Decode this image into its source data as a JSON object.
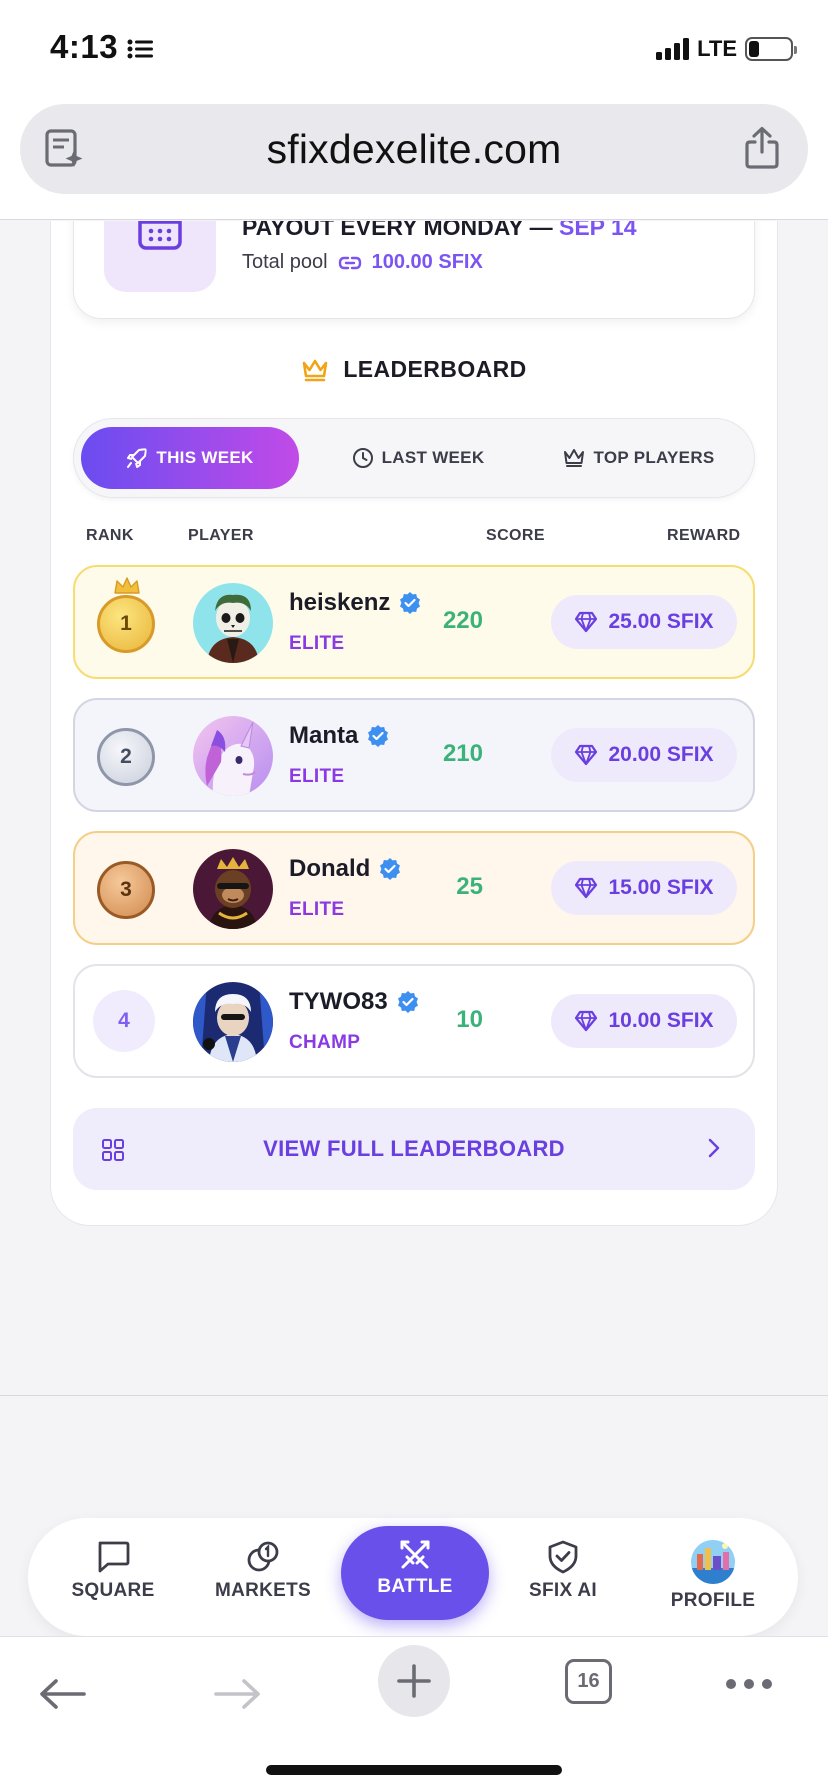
{
  "status_bar": {
    "time": "4:13",
    "network": "LTE"
  },
  "browser": {
    "url": "sfixdexelite.com",
    "tab_count": "16"
  },
  "payout": {
    "title": "PAYOUT EVERY MONDAY — ",
    "date": "SEP 14",
    "pool_label": "Total pool",
    "pool_amount": "100.00 SFIX"
  },
  "leaderboard": {
    "title": "LEADERBOARD",
    "tabs": [
      {
        "label": "THIS WEEK",
        "active": true
      },
      {
        "label": "LAST WEEK",
        "active": false
      },
      {
        "label": "TOP PLAYERS",
        "active": false
      }
    ],
    "columns": {
      "rank": "RANK",
      "player": "PLAYER",
      "score": "SCORE",
      "reward": "REWARD"
    },
    "rows": [
      {
        "rank": "1",
        "name": "heiskenz",
        "tier": "ELITE",
        "score": "220",
        "reward": "25.00 SFIX",
        "verified": true
      },
      {
        "rank": "2",
        "name": "Manta",
        "tier": "ELITE",
        "score": "210",
        "reward": "20.00 SFIX",
        "verified": true
      },
      {
        "rank": "3",
        "name": "Donald",
        "tier": "ELITE",
        "score": "25",
        "reward": "15.00 SFIX",
        "verified": true
      },
      {
        "rank": "4",
        "name": "TYWO83",
        "tier": "CHAMP",
        "score": "10",
        "reward": "10.00 SFIX",
        "verified": true
      }
    ],
    "view_full_label": "VIEW FULL LEADERBOARD"
  },
  "app_nav": {
    "items": [
      {
        "label": "SQUARE",
        "icon": "chat-bubble-icon"
      },
      {
        "label": "MARKETS",
        "icon": "coins-icon"
      },
      {
        "label": "BATTLE",
        "icon": "crossed-swords-icon",
        "active": true
      },
      {
        "label": "SFIX AI",
        "icon": "shield-check-icon"
      },
      {
        "label": "PROFILE",
        "icon": "profile-avatar"
      }
    ]
  },
  "colors": {
    "accent": "#6a50ea",
    "accent_gradient_end": "#c14be8",
    "score_green": "#3bb27a",
    "tier_purple": "#8a3ae3",
    "gold": "#e9b43a",
    "silver": "#c9cedb",
    "bronze": "#d08a4e"
  }
}
